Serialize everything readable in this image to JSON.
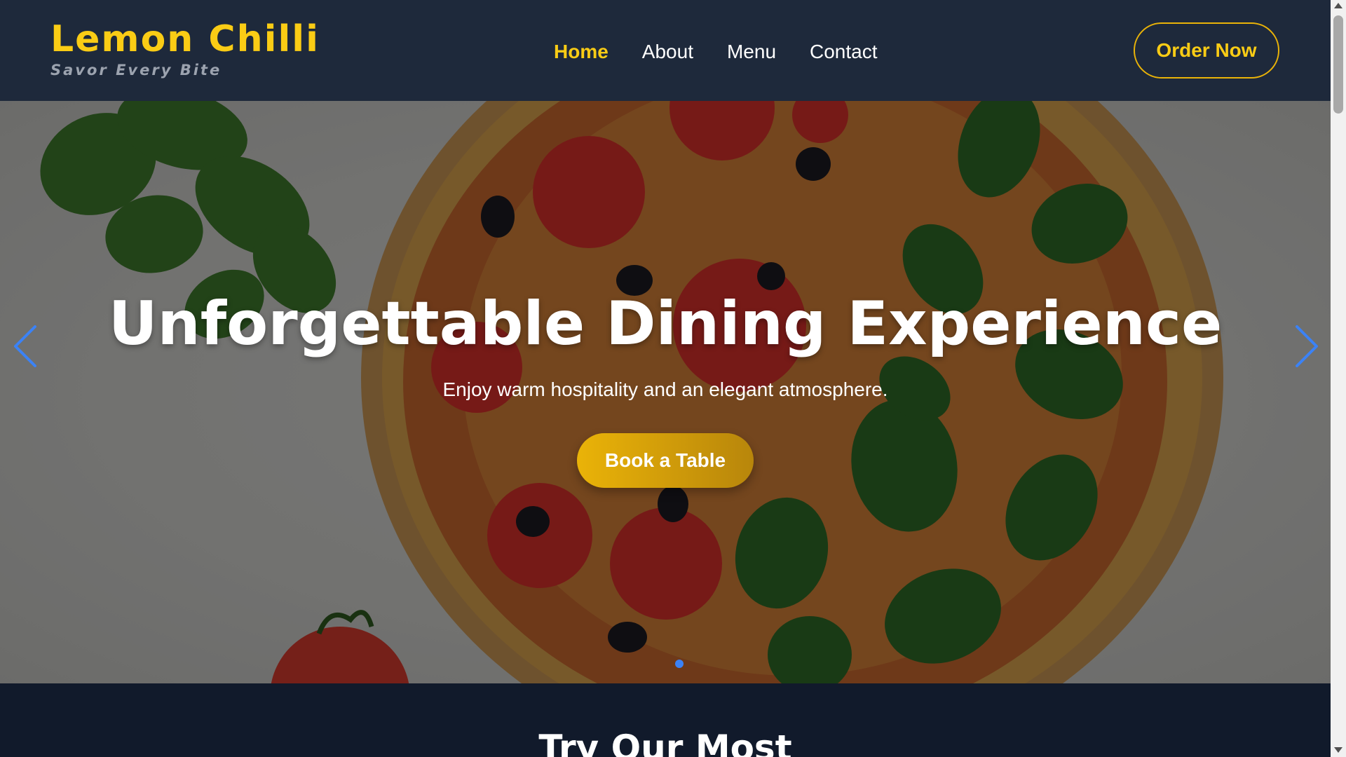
{
  "brand": {
    "name": "Lemon Chilli",
    "tagline": "Savor Every Bite"
  },
  "nav": {
    "items": [
      {
        "label": "Home",
        "active": true
      },
      {
        "label": "About",
        "active": false
      },
      {
        "label": "Menu",
        "active": false
      },
      {
        "label": "Contact",
        "active": false
      }
    ],
    "order_label": "Order Now"
  },
  "hero": {
    "title": "Unforgettable Dining Experience",
    "subtitle": "Enjoy warm hospitality and an elegant atmosphere.",
    "cta_label": "Book a Table",
    "prev_icon": "chevron-left-icon",
    "next_icon": "chevron-right-icon",
    "slide_count": 1,
    "active_slide": 1
  },
  "section": {
    "title": "Try Our Most"
  },
  "colors": {
    "header_bg": "#1e293b",
    "accent": "#facc15",
    "page_bg": "#111a2b",
    "carousel_control": "#3b82f6"
  }
}
